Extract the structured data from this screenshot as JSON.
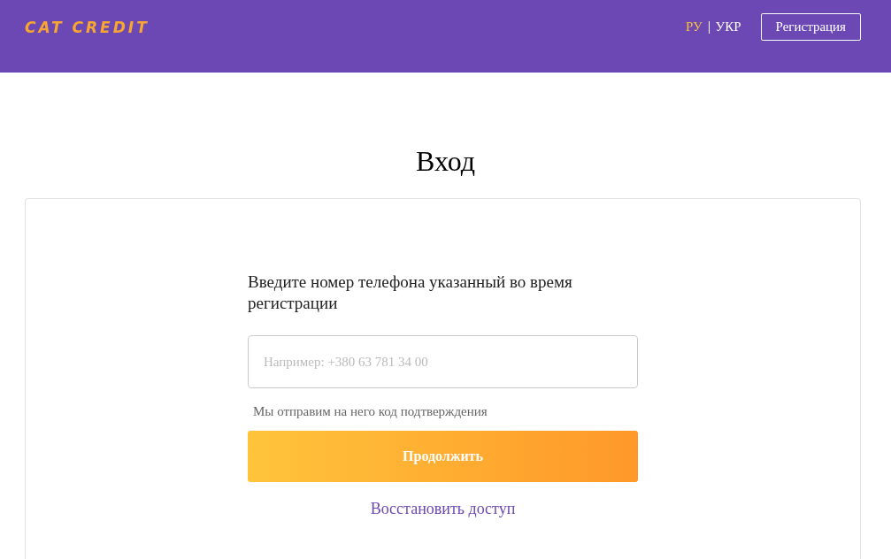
{
  "header": {
    "logo": "CAT CREDIT",
    "languages": [
      {
        "label": "РУ",
        "selected": true
      },
      {
        "label": "УКР",
        "selected": false
      }
    ],
    "register_button": "Регистрация"
  },
  "page_title": "Вход",
  "form": {
    "label": "Введите номер телефона указанный во время регистрации",
    "phone_placeholder": "Например: +380 63 781 34 00",
    "hint": "Мы отправим на него код подтверждения",
    "submit_button": "Продолжить",
    "restore_link": "Восстановить доступ"
  }
}
